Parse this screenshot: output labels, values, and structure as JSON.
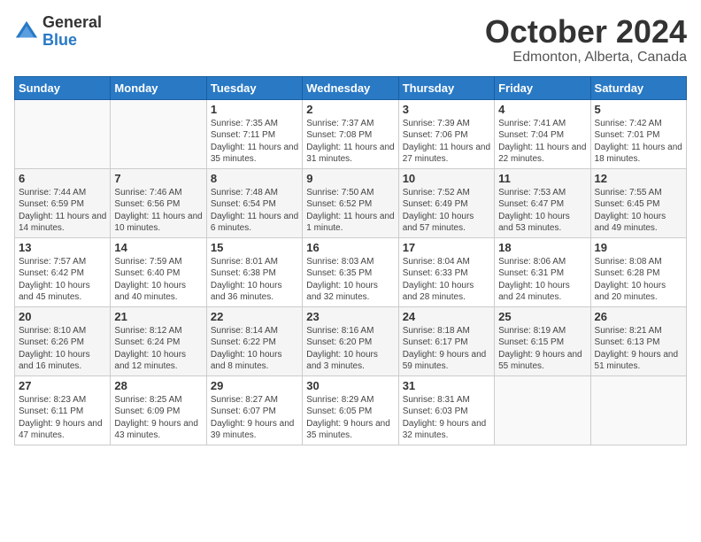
{
  "logo": {
    "general": "General",
    "blue": "Blue"
  },
  "title": {
    "month": "October 2024",
    "location": "Edmonton, Alberta, Canada"
  },
  "headers": [
    "Sunday",
    "Monday",
    "Tuesday",
    "Wednesday",
    "Thursday",
    "Friday",
    "Saturday"
  ],
  "weeks": [
    [
      {
        "day": "",
        "sunrise": "",
        "sunset": "",
        "daylight": ""
      },
      {
        "day": "",
        "sunrise": "",
        "sunset": "",
        "daylight": ""
      },
      {
        "day": "1",
        "sunrise": "Sunrise: 7:35 AM",
        "sunset": "Sunset: 7:11 PM",
        "daylight": "Daylight: 11 hours and 35 minutes."
      },
      {
        "day": "2",
        "sunrise": "Sunrise: 7:37 AM",
        "sunset": "Sunset: 7:08 PM",
        "daylight": "Daylight: 11 hours and 31 minutes."
      },
      {
        "day": "3",
        "sunrise": "Sunrise: 7:39 AM",
        "sunset": "Sunset: 7:06 PM",
        "daylight": "Daylight: 11 hours and 27 minutes."
      },
      {
        "day": "4",
        "sunrise": "Sunrise: 7:41 AM",
        "sunset": "Sunset: 7:04 PM",
        "daylight": "Daylight: 11 hours and 22 minutes."
      },
      {
        "day": "5",
        "sunrise": "Sunrise: 7:42 AM",
        "sunset": "Sunset: 7:01 PM",
        "daylight": "Daylight: 11 hours and 18 minutes."
      }
    ],
    [
      {
        "day": "6",
        "sunrise": "Sunrise: 7:44 AM",
        "sunset": "Sunset: 6:59 PM",
        "daylight": "Daylight: 11 hours and 14 minutes."
      },
      {
        "day": "7",
        "sunrise": "Sunrise: 7:46 AM",
        "sunset": "Sunset: 6:56 PM",
        "daylight": "Daylight: 11 hours and 10 minutes."
      },
      {
        "day": "8",
        "sunrise": "Sunrise: 7:48 AM",
        "sunset": "Sunset: 6:54 PM",
        "daylight": "Daylight: 11 hours and 6 minutes."
      },
      {
        "day": "9",
        "sunrise": "Sunrise: 7:50 AM",
        "sunset": "Sunset: 6:52 PM",
        "daylight": "Daylight: 11 hours and 1 minute."
      },
      {
        "day": "10",
        "sunrise": "Sunrise: 7:52 AM",
        "sunset": "Sunset: 6:49 PM",
        "daylight": "Daylight: 10 hours and 57 minutes."
      },
      {
        "day": "11",
        "sunrise": "Sunrise: 7:53 AM",
        "sunset": "Sunset: 6:47 PM",
        "daylight": "Daylight: 10 hours and 53 minutes."
      },
      {
        "day": "12",
        "sunrise": "Sunrise: 7:55 AM",
        "sunset": "Sunset: 6:45 PM",
        "daylight": "Daylight: 10 hours and 49 minutes."
      }
    ],
    [
      {
        "day": "13",
        "sunrise": "Sunrise: 7:57 AM",
        "sunset": "Sunset: 6:42 PM",
        "daylight": "Daylight: 10 hours and 45 minutes."
      },
      {
        "day": "14",
        "sunrise": "Sunrise: 7:59 AM",
        "sunset": "Sunset: 6:40 PM",
        "daylight": "Daylight: 10 hours and 40 minutes."
      },
      {
        "day": "15",
        "sunrise": "Sunrise: 8:01 AM",
        "sunset": "Sunset: 6:38 PM",
        "daylight": "Daylight: 10 hours and 36 minutes."
      },
      {
        "day": "16",
        "sunrise": "Sunrise: 8:03 AM",
        "sunset": "Sunset: 6:35 PM",
        "daylight": "Daylight: 10 hours and 32 minutes."
      },
      {
        "day": "17",
        "sunrise": "Sunrise: 8:04 AM",
        "sunset": "Sunset: 6:33 PM",
        "daylight": "Daylight: 10 hours and 28 minutes."
      },
      {
        "day": "18",
        "sunrise": "Sunrise: 8:06 AM",
        "sunset": "Sunset: 6:31 PM",
        "daylight": "Daylight: 10 hours and 24 minutes."
      },
      {
        "day": "19",
        "sunrise": "Sunrise: 8:08 AM",
        "sunset": "Sunset: 6:28 PM",
        "daylight": "Daylight: 10 hours and 20 minutes."
      }
    ],
    [
      {
        "day": "20",
        "sunrise": "Sunrise: 8:10 AM",
        "sunset": "Sunset: 6:26 PM",
        "daylight": "Daylight: 10 hours and 16 minutes."
      },
      {
        "day": "21",
        "sunrise": "Sunrise: 8:12 AM",
        "sunset": "Sunset: 6:24 PM",
        "daylight": "Daylight: 10 hours and 12 minutes."
      },
      {
        "day": "22",
        "sunrise": "Sunrise: 8:14 AM",
        "sunset": "Sunset: 6:22 PM",
        "daylight": "Daylight: 10 hours and 8 minutes."
      },
      {
        "day": "23",
        "sunrise": "Sunrise: 8:16 AM",
        "sunset": "Sunset: 6:20 PM",
        "daylight": "Daylight: 10 hours and 3 minutes."
      },
      {
        "day": "24",
        "sunrise": "Sunrise: 8:18 AM",
        "sunset": "Sunset: 6:17 PM",
        "daylight": "Daylight: 9 hours and 59 minutes."
      },
      {
        "day": "25",
        "sunrise": "Sunrise: 8:19 AM",
        "sunset": "Sunset: 6:15 PM",
        "daylight": "Daylight: 9 hours and 55 minutes."
      },
      {
        "day": "26",
        "sunrise": "Sunrise: 8:21 AM",
        "sunset": "Sunset: 6:13 PM",
        "daylight": "Daylight: 9 hours and 51 minutes."
      }
    ],
    [
      {
        "day": "27",
        "sunrise": "Sunrise: 8:23 AM",
        "sunset": "Sunset: 6:11 PM",
        "daylight": "Daylight: 9 hours and 47 minutes."
      },
      {
        "day": "28",
        "sunrise": "Sunrise: 8:25 AM",
        "sunset": "Sunset: 6:09 PM",
        "daylight": "Daylight: 9 hours and 43 minutes."
      },
      {
        "day": "29",
        "sunrise": "Sunrise: 8:27 AM",
        "sunset": "Sunset: 6:07 PM",
        "daylight": "Daylight: 9 hours and 39 minutes."
      },
      {
        "day": "30",
        "sunrise": "Sunrise: 8:29 AM",
        "sunset": "Sunset: 6:05 PM",
        "daylight": "Daylight: 9 hours and 35 minutes."
      },
      {
        "day": "31",
        "sunrise": "Sunrise: 8:31 AM",
        "sunset": "Sunset: 6:03 PM",
        "daylight": "Daylight: 9 hours and 32 minutes."
      },
      {
        "day": "",
        "sunrise": "",
        "sunset": "",
        "daylight": ""
      },
      {
        "day": "",
        "sunrise": "",
        "sunset": "",
        "daylight": ""
      }
    ]
  ]
}
